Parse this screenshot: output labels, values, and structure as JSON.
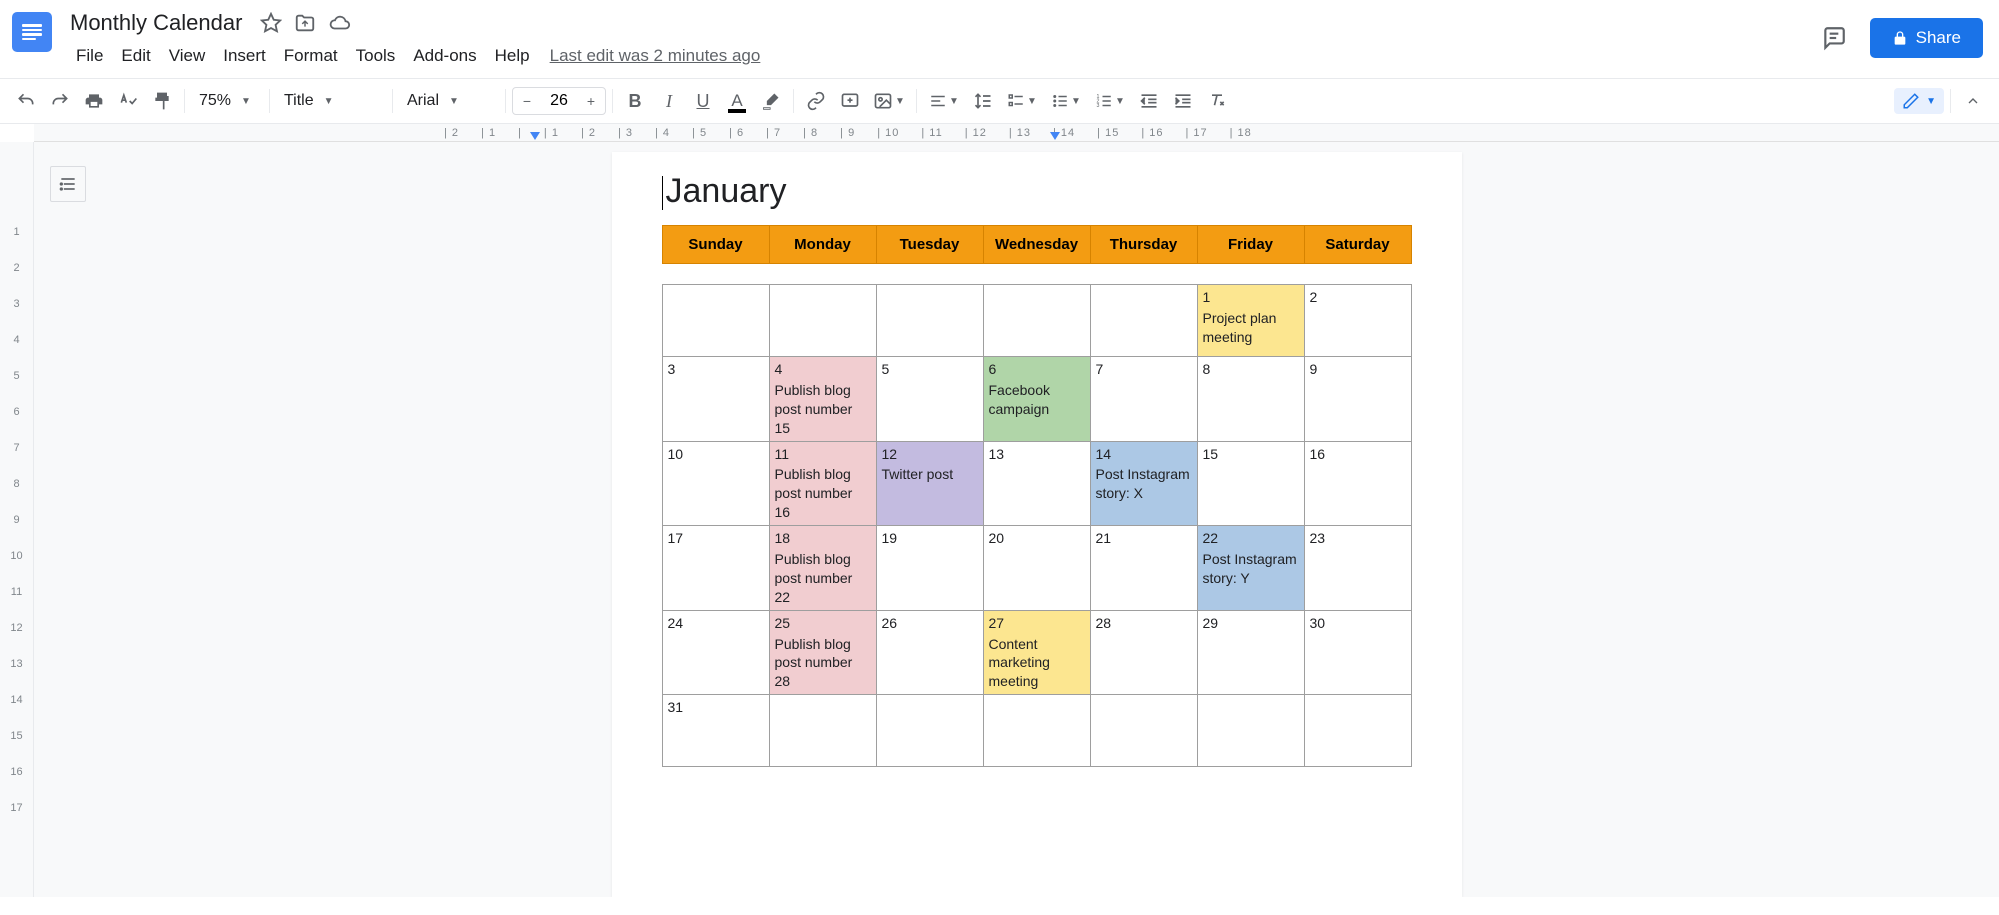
{
  "header": {
    "doc_title": "Monthly Calendar",
    "menus": [
      "File",
      "Edit",
      "View",
      "Insert",
      "Format",
      "Tools",
      "Add-ons",
      "Help"
    ],
    "last_edit": "Last edit was 2 minutes ago",
    "share_label": "Share"
  },
  "toolbar": {
    "zoom": "75%",
    "paragraph_style": "Title",
    "font": "Arial",
    "font_size": "26"
  },
  "ruler_h": [
    "2",
    "1",
    "",
    "1",
    "2",
    "3",
    "4",
    "5",
    "6",
    "7",
    "8",
    "9",
    "10",
    "11",
    "12",
    "13",
    "14",
    "15",
    "16",
    "17",
    "18"
  ],
  "ruler_v": [
    "",
    "1",
    "2",
    "3",
    "4",
    "5",
    "6",
    "7",
    "8",
    "9",
    "10",
    "11",
    "12",
    "13",
    "14",
    "15",
    "16",
    "17"
  ],
  "calendar": {
    "month_title": "January",
    "days": [
      "Sunday",
      "Monday",
      "Tuesday",
      "Wednesday",
      "Thursday",
      "Friday",
      "Saturday"
    ],
    "weeks": [
      [
        {
          "num": "",
          "text": "",
          "color": ""
        },
        {
          "num": "",
          "text": "",
          "color": ""
        },
        {
          "num": "",
          "text": "",
          "color": ""
        },
        {
          "num": "",
          "text": "",
          "color": ""
        },
        {
          "num": "",
          "text": "",
          "color": ""
        },
        {
          "num": "1",
          "text": "Project plan meeting",
          "color": "c-yellow"
        },
        {
          "num": "2",
          "text": "",
          "color": ""
        }
      ],
      [
        {
          "num": "3",
          "text": "",
          "color": ""
        },
        {
          "num": "4",
          "text": "Publish blog post number 15",
          "color": "c-pink"
        },
        {
          "num": "5",
          "text": "",
          "color": ""
        },
        {
          "num": "6",
          "text": "Facebook campaign",
          "color": "c-green"
        },
        {
          "num": "7",
          "text": "",
          "color": ""
        },
        {
          "num": "8",
          "text": "",
          "color": ""
        },
        {
          "num": "9",
          "text": "",
          "color": ""
        }
      ],
      [
        {
          "num": "10",
          "text": "",
          "color": ""
        },
        {
          "num": "11",
          "text": "Publish blog post number 16",
          "color": "c-pink"
        },
        {
          "num": "12",
          "text": "Twitter post",
          "color": "c-purple"
        },
        {
          "num": "13",
          "text": "",
          "color": ""
        },
        {
          "num": "14",
          "text": "Post Instagram story: X",
          "color": "c-blue"
        },
        {
          "num": "15",
          "text": "",
          "color": ""
        },
        {
          "num": "16",
          "text": "",
          "color": ""
        }
      ],
      [
        {
          "num": "17",
          "text": "",
          "color": ""
        },
        {
          "num": "18",
          "text": "Publish blog post number 22",
          "color": "c-pink"
        },
        {
          "num": "19",
          "text": "",
          "color": ""
        },
        {
          "num": "20",
          "text": "",
          "color": ""
        },
        {
          "num": "21",
          "text": "",
          "color": ""
        },
        {
          "num": "22",
          "text": "Post Instagram story: Y",
          "color": "c-blue"
        },
        {
          "num": "23",
          "text": "",
          "color": ""
        }
      ],
      [
        {
          "num": "24",
          "text": "",
          "color": ""
        },
        {
          "num": "25",
          "text": "Publish blog post number 28",
          "color": "c-pink"
        },
        {
          "num": "26",
          "text": "",
          "color": ""
        },
        {
          "num": "27",
          "text": "Content marketing meeting",
          "color": "c-yellow"
        },
        {
          "num": "28",
          "text": "",
          "color": ""
        },
        {
          "num": "29",
          "text": "",
          "color": ""
        },
        {
          "num": "30",
          "text": "",
          "color": ""
        }
      ],
      [
        {
          "num": "31",
          "text": "",
          "color": ""
        },
        {
          "num": "",
          "text": "",
          "color": ""
        },
        {
          "num": "",
          "text": "",
          "color": ""
        },
        {
          "num": "",
          "text": "",
          "color": ""
        },
        {
          "num": "",
          "text": "",
          "color": ""
        },
        {
          "num": "",
          "text": "",
          "color": ""
        },
        {
          "num": "",
          "text": "",
          "color": ""
        }
      ]
    ]
  }
}
